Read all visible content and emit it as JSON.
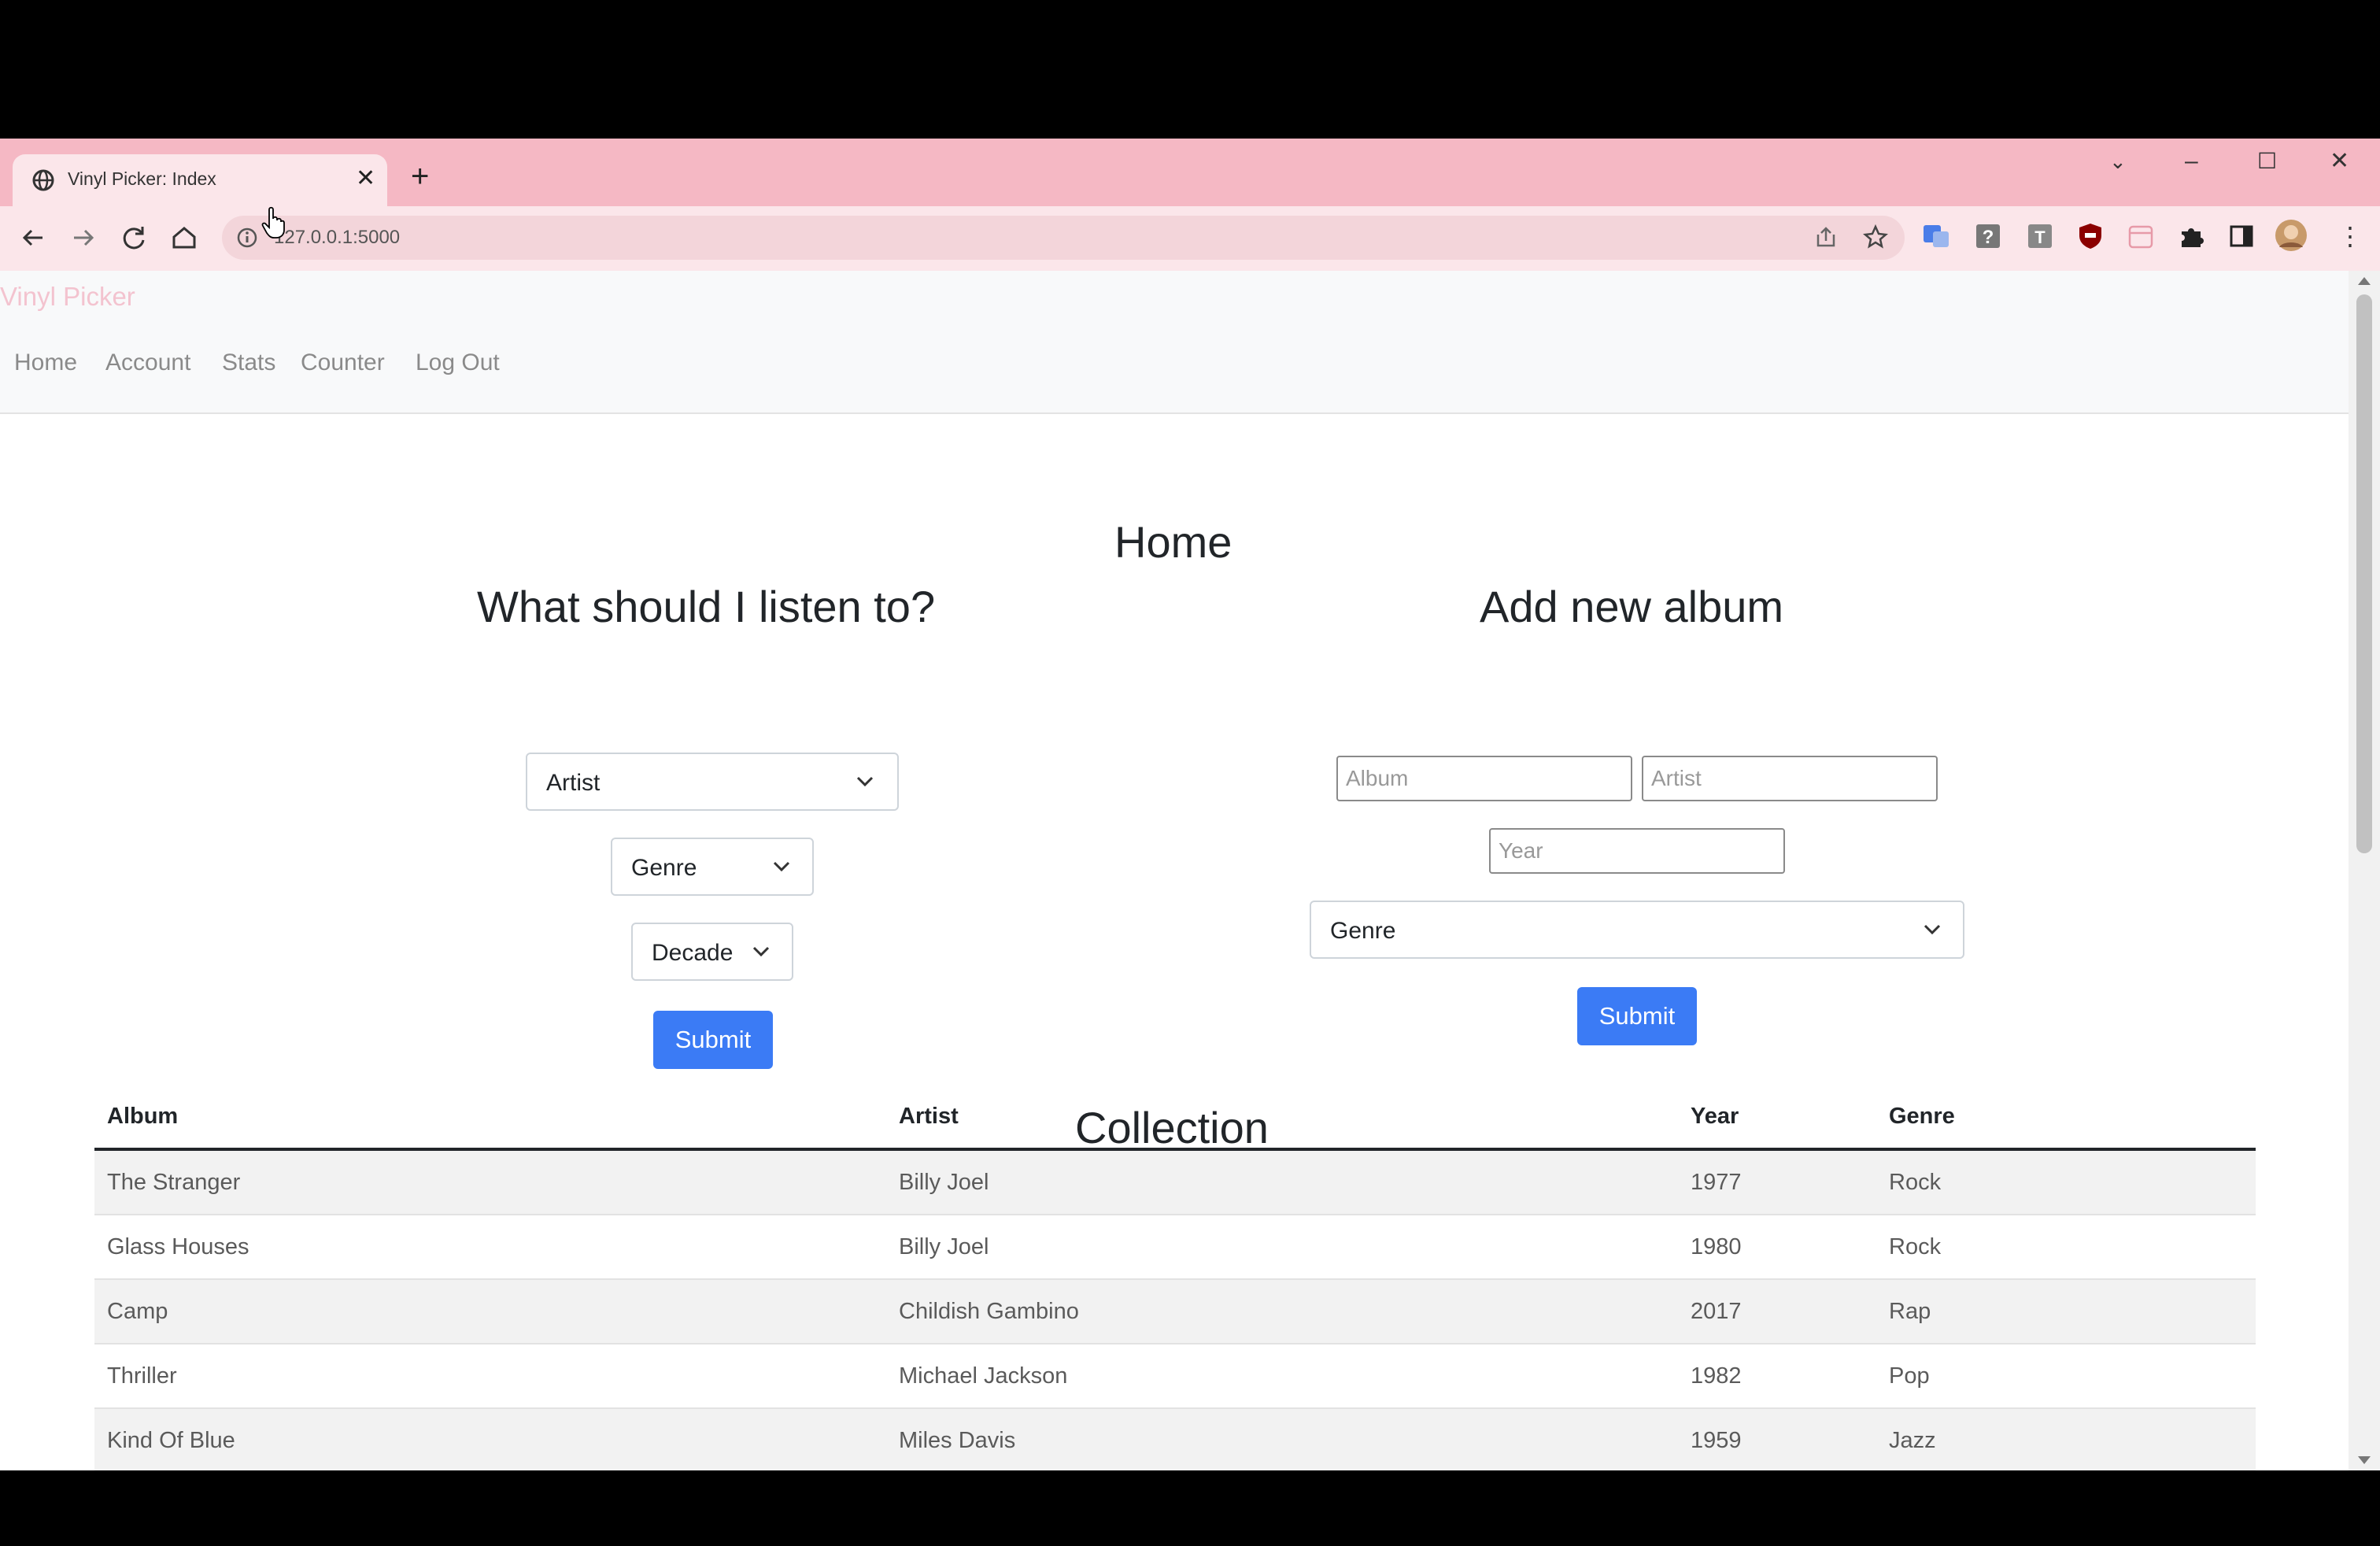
{
  "browser": {
    "tab_title": "Vinyl Picker: Index",
    "url": "127.0.0.1:5000",
    "icons": [
      "globe-icon",
      "close-icon",
      "plus-icon",
      "chevron-down-icon",
      "minimize-icon",
      "maximize-icon",
      "close-window-icon",
      "back-icon",
      "forward-icon",
      "reload-icon",
      "home-icon",
      "info-icon",
      "share-icon",
      "star-icon",
      "translate-extension-icon",
      "help-extension-icon",
      "t-extension-icon",
      "shield-extension-icon",
      "calendar-extension-icon",
      "puzzle-icon",
      "sidepanel-icon",
      "avatar",
      "more-icon"
    ]
  },
  "navbar": {
    "brand": "Vinyl Picker",
    "links": [
      "Home",
      "Account",
      "Stats",
      "Counter",
      "Log Out"
    ]
  },
  "main": {
    "page_title": "Home",
    "picker": {
      "title": "What should I listen to?",
      "artist_select": "Artist",
      "genre_select": "Genre",
      "decade_select": "Decade",
      "submit_label": "Submit"
    },
    "add_album": {
      "title": "Add new album",
      "album_placeholder": "Album",
      "artist_placeholder": "Artist",
      "year_placeholder": "Year",
      "genre_select": "Genre",
      "submit_label": "Submit"
    },
    "collection": {
      "title": "Collection",
      "headers": [
        "Album",
        "Artist",
        "Year",
        "Genre"
      ],
      "rows": [
        [
          "The Stranger",
          "Billy Joel",
          "1977",
          "Rock"
        ],
        [
          "Glass Houses",
          "Billy Joel",
          "1980",
          "Rock"
        ],
        [
          "Camp",
          "Childish Gambino",
          "2017",
          "Rap"
        ],
        [
          "Thriller",
          "Michael Jackson",
          "1982",
          "Pop"
        ],
        [
          "Kind Of Blue",
          "Miles Davis",
          "1959",
          "Jazz"
        ]
      ]
    }
  },
  "colors": {
    "tab_strip": "#f5b8c4",
    "toolbar": "#fbe6ea",
    "brand": "#f3c3cf",
    "primary_button": "#3b7bf5"
  }
}
